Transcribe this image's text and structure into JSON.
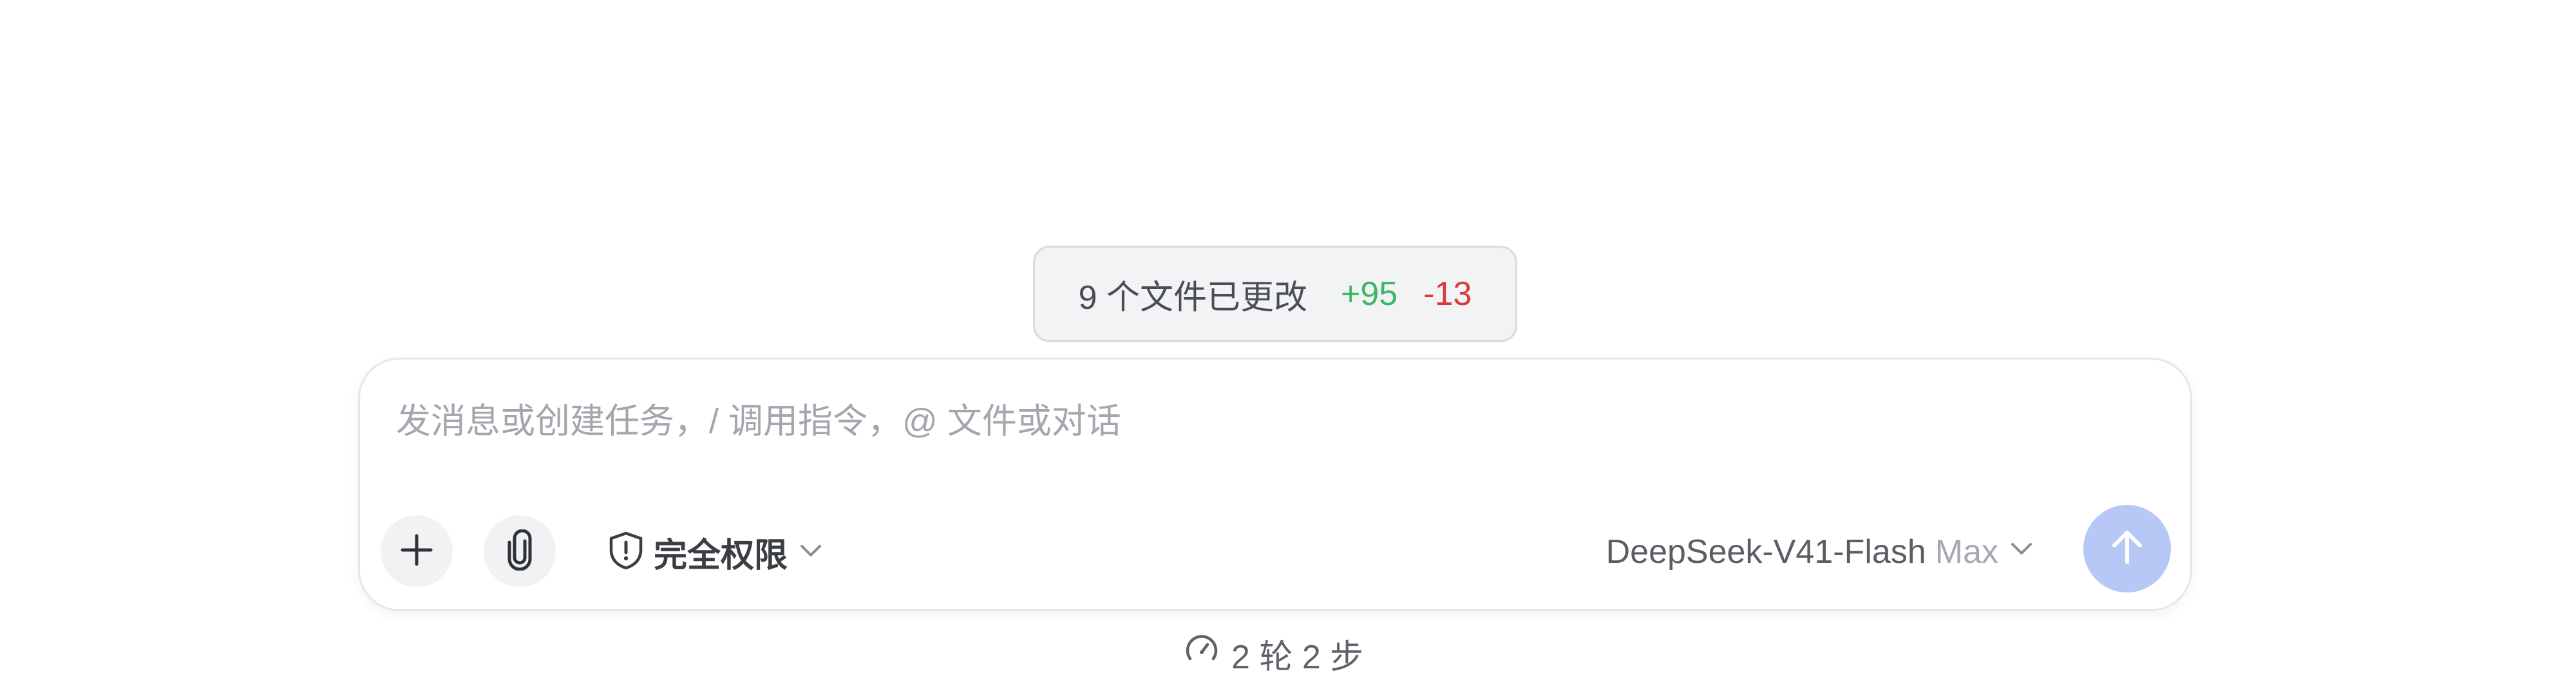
{
  "changes": {
    "summary": "9 个文件已更改",
    "added": "+95",
    "removed": "-13"
  },
  "composer": {
    "placeholder": "发消息或创建任务，/ 调用指令，@ 文件或对话",
    "value": "",
    "permission_label": "完全权限",
    "model_name": "DeepSeek-V41-Flash",
    "model_tier": "Max"
  },
  "status": {
    "text": "2 轮 2 步"
  },
  "icons": {
    "add": "plus-icon",
    "attach": "paperclip-icon",
    "permission": "shield-icon",
    "dropdown": "chevron-down-icon",
    "send": "arrow-up-icon",
    "stats": "gauge-icon"
  },
  "colors": {
    "added": "#3db566",
    "removed": "#d83b3b",
    "send_button": "#b7c8f6"
  }
}
